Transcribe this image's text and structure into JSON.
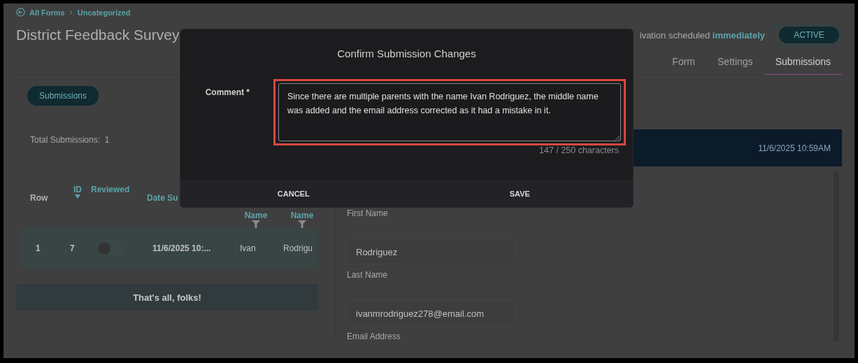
{
  "breadcrumb": [
    {
      "label": "All Forms"
    },
    {
      "label": "Uncategorized"
    }
  ],
  "title": "District Feedback Survey",
  "schedule": {
    "text": "ivation scheduled",
    "emphasis": "immediately"
  },
  "status_toggle": {
    "label": "ACTIVE",
    "on": true
  },
  "tabs": [
    {
      "label": "Form",
      "selected": false
    },
    {
      "label": "Settings",
      "selected": false
    },
    {
      "label": "Submissions",
      "selected": true
    }
  ],
  "submissions_button": "Submissions",
  "total": {
    "label": "Total Submissions:",
    "value": "1"
  },
  "table": {
    "columns": [
      {
        "label": "Row",
        "kind": "plain"
      },
      {
        "label": "ID",
        "kind": "sort"
      },
      {
        "label": "Reviewed",
        "kind": "link"
      },
      {
        "label": "Date Su",
        "kind": "link"
      },
      {
        "label": "Name",
        "kind": "filter"
      },
      {
        "label": "Name",
        "kind": "filter"
      }
    ],
    "rows": [
      {
        "row": "1",
        "id": "7",
        "reviewed": false,
        "date": "11/6/2025 10:...",
        "first": "Ivan",
        "last": "Rodrigu"
      }
    ]
  },
  "end_note": "That's all, folks!",
  "detail": {
    "timestamp": "11/6/2025 10:59AM",
    "fields": [
      {
        "label": "First Name"
      },
      {
        "value": "Rodriguez",
        "label": "Last Name"
      },
      {
        "value": "ivanmrodriguez278@email.com",
        "label": "Email Address"
      }
    ]
  },
  "dialog": {
    "title": "Confirm Submission Changes",
    "comment_label": "Comment *",
    "comment": "Since there are multiple parents with the name Ivan Rodriguez, the middle name was added and the email address corrected as it had a mistake in it.",
    "counter": "147 / 250 characters",
    "buttons": [
      "CANCEL",
      "SAVE"
    ]
  }
}
